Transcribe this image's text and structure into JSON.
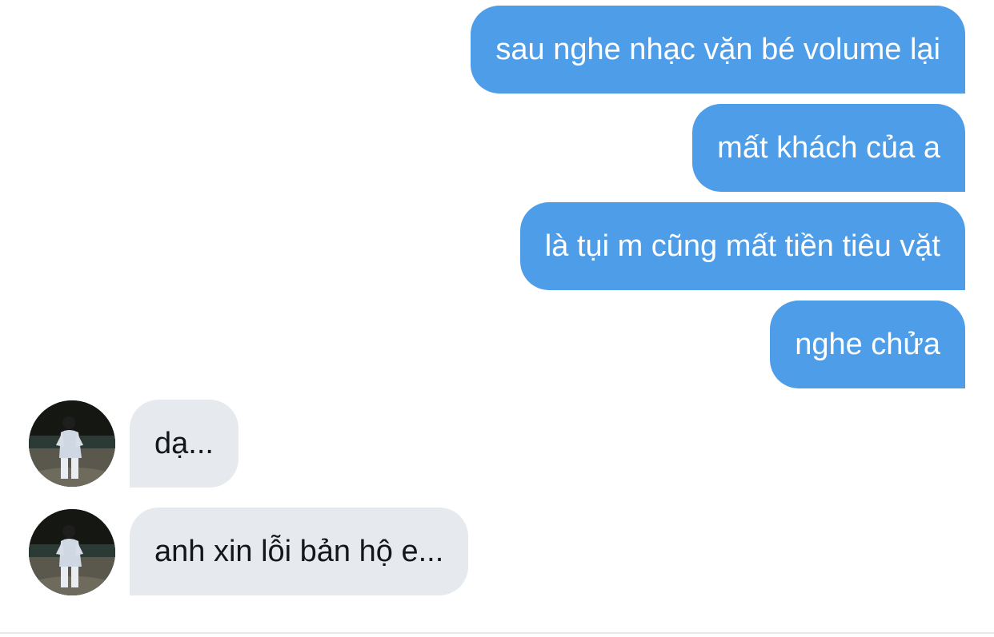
{
  "conversation": {
    "messages": [
      {
        "sender": "me",
        "text": "sau nghe nhạc vặn bé volume lại"
      },
      {
        "sender": "me",
        "text": "mất khách của a"
      },
      {
        "sender": "me",
        "text": "là tụi m cũng mất tiền tiêu vặt"
      },
      {
        "sender": "me",
        "text": "nghe chửa"
      },
      {
        "sender": "other",
        "text": "dạ..."
      },
      {
        "sender": "other",
        "text": "anh xin lỗi bản hộ e..."
      }
    ]
  },
  "colors": {
    "sent_bubble": "#4d9de8",
    "received_bubble": "#e6e9ee",
    "sent_text": "#ffffff",
    "received_text": "#14171a",
    "background": "#ffffff"
  },
  "icons": {
    "avatar": "profile-photo-person-on-beach-at-night"
  }
}
